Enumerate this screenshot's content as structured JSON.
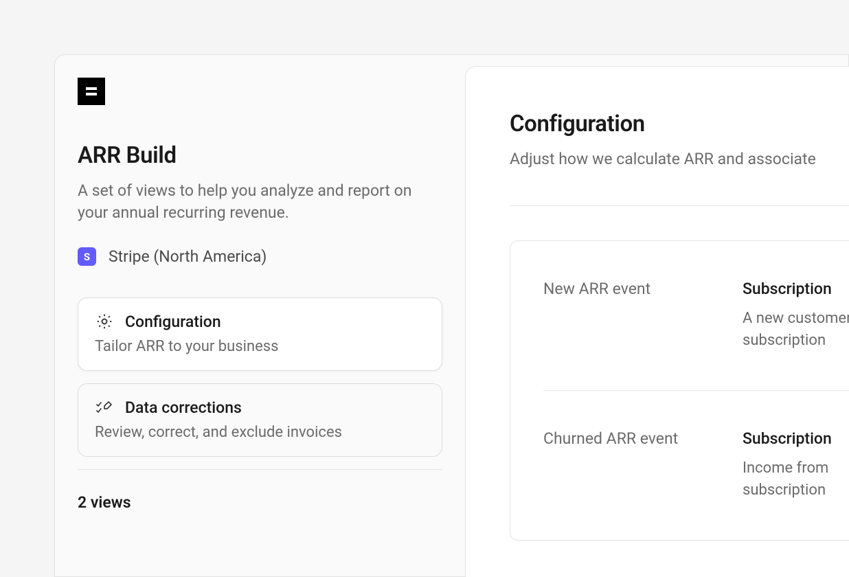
{
  "logo": {
    "glyph": "E"
  },
  "left": {
    "title": "ARR Build",
    "description": "A set of views to help you analyze and report on your annual recurring revenue.",
    "source_badge": "S",
    "source_label": "Stripe (North America)",
    "cards": [
      {
        "icon": "gear-icon",
        "title": "Configuration",
        "subtitle": "Tailor ARR to your business",
        "active": true
      },
      {
        "icon": "edit-list-icon",
        "title": "Data corrections",
        "subtitle": "Review, correct, and exclude invoices",
        "active": false
      }
    ],
    "views_heading": "2 views"
  },
  "right": {
    "title": "Configuration",
    "description": "Adjust how we calculate ARR and associate",
    "rows": [
      {
        "label": "New ARR event",
        "value_title": "Subscription",
        "value_desc": "A new customer subscription"
      },
      {
        "label": "Churned ARR event",
        "value_title": "Subscription",
        "value_desc": "Income from subscription"
      }
    ]
  }
}
